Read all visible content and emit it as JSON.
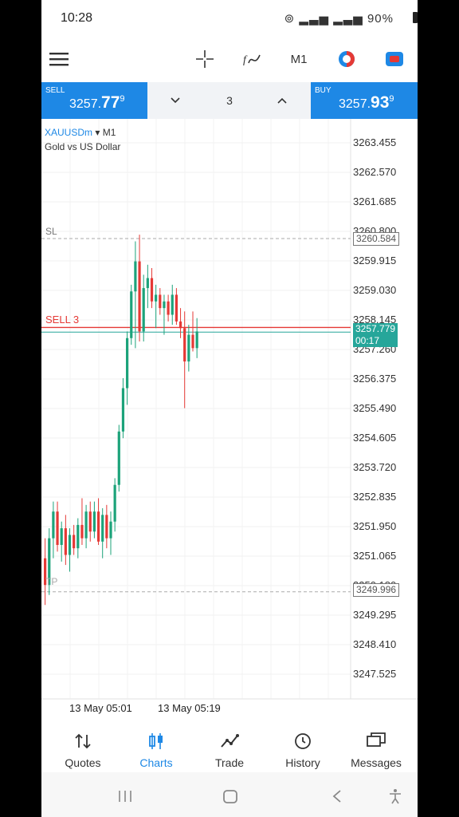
{
  "status_bar": {
    "time": "10:28",
    "battery": "90%"
  },
  "toolbar": {
    "timeframe": "M1"
  },
  "trade_panel": {
    "sell_label": "SELL",
    "sell_price_prefix": "3257.",
    "sell_price_big": "77",
    "sell_price_sup": "9",
    "buy_label": "BUY",
    "buy_price_prefix": "3257.",
    "buy_price_big": "93",
    "buy_price_sup": "9",
    "volume": "3"
  },
  "chart": {
    "symbol": "XAUUSDm",
    "timeframe": "M1",
    "description": "Gold vs US Dollar",
    "sl_label": "SL",
    "sl_price": "3260.584",
    "tp_label": "TP",
    "tp_price": "3249.996",
    "order_label": "SELL 3",
    "bid_price": "3257.779",
    "countdown": "00:17",
    "x_labels": [
      "13 May 05:01",
      "13 May 05:19"
    ],
    "colors": {
      "bull": "#1ca37a",
      "bear": "#e53935",
      "order": "#e53935",
      "bid": "#26a69a",
      "accent": "#1e88e5"
    }
  },
  "chart_data": {
    "type": "candlestick",
    "y_ticks": [
      "3263.455",
      "3262.570",
      "3261.685",
      "3260.800",
      "3259.915",
      "3259.030",
      "3258.145",
      "3257.260",
      "3256.375",
      "3255.490",
      "3254.605",
      "3253.720",
      "3252.835",
      "3251.950",
      "3251.065",
      "3250.180",
      "3249.295",
      "3248.410",
      "3247.525"
    ],
    "ylim": [
      3246.8,
      3264.0
    ],
    "candles": [
      {
        "o": 3251.0,
        "h": 3251.6,
        "l": 3249.6,
        "c": 3250.2
      },
      {
        "o": 3250.2,
        "h": 3251.9,
        "l": 3249.9,
        "c": 3251.6
      },
      {
        "o": 3251.6,
        "h": 3252.7,
        "l": 3251.0,
        "c": 3252.4
      },
      {
        "o": 3252.4,
        "h": 3252.7,
        "l": 3251.2,
        "c": 3251.4
      },
      {
        "o": 3251.4,
        "h": 3252.1,
        "l": 3250.9,
        "c": 3251.9
      },
      {
        "o": 3251.9,
        "h": 3252.3,
        "l": 3250.8,
        "c": 3251.1
      },
      {
        "o": 3251.1,
        "h": 3251.9,
        "l": 3250.6,
        "c": 3251.7
      },
      {
        "o": 3251.7,
        "h": 3252.0,
        "l": 3251.1,
        "c": 3251.3
      },
      {
        "o": 3251.3,
        "h": 3252.2,
        "l": 3251.0,
        "c": 3252.0
      },
      {
        "o": 3252.0,
        "h": 3252.8,
        "l": 3251.4,
        "c": 3251.6
      },
      {
        "o": 3251.6,
        "h": 3252.6,
        "l": 3251.3,
        "c": 3252.4
      },
      {
        "o": 3252.4,
        "h": 3252.7,
        "l": 3251.5,
        "c": 3251.8
      },
      {
        "o": 3251.8,
        "h": 3252.7,
        "l": 3251.6,
        "c": 3252.4
      },
      {
        "o": 3252.4,
        "h": 3252.8,
        "l": 3251.4,
        "c": 3251.5
      },
      {
        "o": 3251.5,
        "h": 3252.5,
        "l": 3251.0,
        "c": 3252.3
      },
      {
        "o": 3252.3,
        "h": 3252.6,
        "l": 3251.3,
        "c": 3251.6
      },
      {
        "o": 3251.6,
        "h": 3252.4,
        "l": 3251.1,
        "c": 3252.1
      },
      {
        "o": 3252.1,
        "h": 3253.4,
        "l": 3251.8,
        "c": 3253.2
      },
      {
        "o": 3253.2,
        "h": 3255.0,
        "l": 3253.0,
        "c": 3254.8
      },
      {
        "o": 3254.8,
        "h": 3256.4,
        "l": 3254.6,
        "c": 3256.1
      },
      {
        "o": 3256.1,
        "h": 3257.8,
        "l": 3255.6,
        "c": 3257.6
      },
      {
        "o": 3257.6,
        "h": 3259.2,
        "l": 3257.4,
        "c": 3259.0
      },
      {
        "o": 3259.0,
        "h": 3260.5,
        "l": 3257.3,
        "c": 3259.9
      },
      {
        "o": 3259.9,
        "h": 3260.7,
        "l": 3257.5,
        "c": 3257.8
      },
      {
        "o": 3257.8,
        "h": 3259.5,
        "l": 3257.5,
        "c": 3259.1
      },
      {
        "o": 3259.1,
        "h": 3259.8,
        "l": 3258.5,
        "c": 3259.4
      },
      {
        "o": 3259.4,
        "h": 3259.7,
        "l": 3258.5,
        "c": 3258.7
      },
      {
        "o": 3258.7,
        "h": 3259.2,
        "l": 3257.9,
        "c": 3258.9
      },
      {
        "o": 3258.9,
        "h": 3259.1,
        "l": 3258.3,
        "c": 3258.5
      },
      {
        "o": 3258.5,
        "h": 3258.9,
        "l": 3257.7,
        "c": 3258.7
      },
      {
        "o": 3258.7,
        "h": 3258.9,
        "l": 3258.1,
        "c": 3258.3
      },
      {
        "o": 3258.3,
        "h": 3259.2,
        "l": 3258.0,
        "c": 3258.9
      },
      {
        "o": 3258.9,
        "h": 3259.1,
        "l": 3258.0,
        "c": 3258.1
      },
      {
        "o": 3258.1,
        "h": 3258.5,
        "l": 3257.6,
        "c": 3257.9
      },
      {
        "o": 3257.9,
        "h": 3258.4,
        "l": 3255.5,
        "c": 3256.9
      },
      {
        "o": 3256.9,
        "h": 3258.0,
        "l": 3256.6,
        "c": 3257.7
      },
      {
        "o": 3257.7,
        "h": 3258.4,
        "l": 3257.2,
        "c": 3257.3
      },
      {
        "o": 3257.3,
        "h": 3258.2,
        "l": 3257.0,
        "c": 3257.8
      }
    ]
  },
  "bottom_nav": {
    "items": [
      {
        "label": "Quotes"
      },
      {
        "label": "Charts"
      },
      {
        "label": "Trade"
      },
      {
        "label": "History"
      },
      {
        "label": "Messages"
      }
    ]
  }
}
